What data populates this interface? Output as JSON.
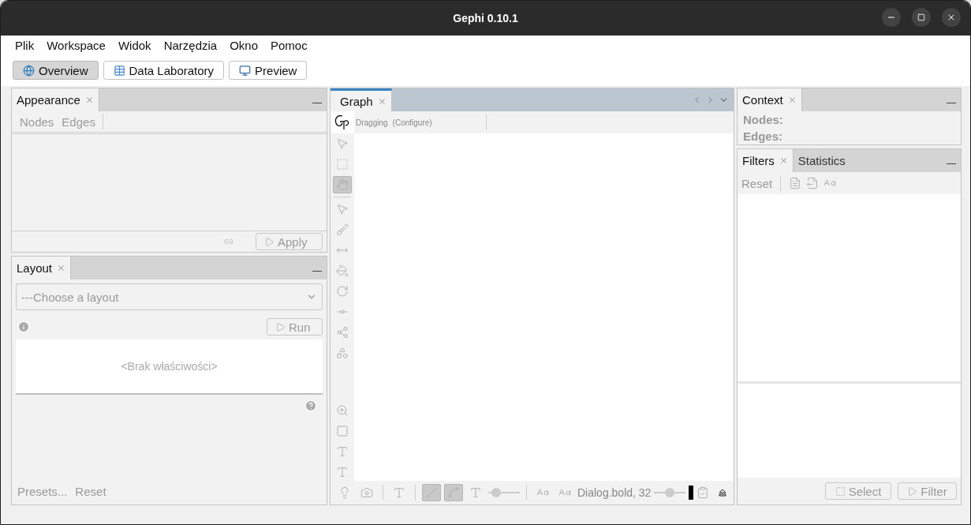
{
  "window": {
    "title": "Gephi 0.10.1"
  },
  "menu": [
    "Plik",
    "Workspace",
    "Widok",
    "Narzędzia",
    "Okno",
    "Pomoc"
  ],
  "perspectives": [
    {
      "label": "Overview",
      "kind": "globe",
      "selected": true
    },
    {
      "label": "Data Laboratory",
      "kind": "table",
      "selected": false
    },
    {
      "label": "Preview",
      "kind": "monitor",
      "selected": false
    }
  ],
  "appearance": {
    "tabs": [
      {
        "label": "Appearance",
        "selected": true
      }
    ],
    "subtabs": [
      "Nodes",
      "Edges"
    ],
    "apply": {
      "label": "Apply",
      "disabled": true
    }
  },
  "layout": {
    "tabs": [
      {
        "label": "Layout",
        "selected": true
      }
    ],
    "placeholder": "---Choose a layout",
    "run": {
      "label": "Run",
      "disabled": true
    },
    "properties": "<Brak właściwości>",
    "presets": "Presets...",
    "reset": "Reset"
  },
  "graph": {
    "tabs": [
      {
        "label": "Graph",
        "selected": true
      }
    ],
    "mode": "Dragging",
    "configure": "(Configure)",
    "tool_groups": [
      [
        {
          "kind": "pointer",
          "selected": false
        },
        {
          "kind": "rect-select",
          "selected": false
        },
        {
          "kind": "hand",
          "selected": true
        }
      ],
      [
        {
          "kind": "pointer-help",
          "selected": false
        },
        {
          "kind": "brush",
          "selected": false
        },
        {
          "kind": "resize",
          "selected": false
        },
        {
          "kind": "bucket",
          "selected": false
        },
        {
          "kind": "rotate",
          "selected": false
        },
        {
          "kind": "add-node",
          "selected": false
        },
        {
          "kind": "add-edge",
          "selected": false
        },
        {
          "kind": "cluster",
          "selected": false
        }
      ],
      [
        {
          "kind": "zoom",
          "selected": false
        },
        {
          "kind": "square",
          "selected": false
        },
        {
          "kind": "text-underline",
          "selected": false
        },
        {
          "kind": "text-shadow",
          "selected": false
        }
      ]
    ],
    "bottom_groups": [
      [
        {
          "kind": "bulb",
          "selected": false
        },
        {
          "kind": "camera",
          "selected": false
        }
      ],
      [
        {
          "kind": "text-bold",
          "selected": false
        }
      ],
      [
        {
          "kind": "edge",
          "selected": true
        },
        {
          "kind": "edge-curve",
          "selected": true
        },
        {
          "kind": "text-serif",
          "selected": false
        }
      ]
    ],
    "edge_slider": {
      "level": 0.15
    },
    "font_tools": [
      {
        "kind": "font-size",
        "selected": false
      },
      {
        "kind": "font-size",
        "selected": false
      }
    ],
    "font_label": "Dialog.bold, 32",
    "size_slider": {
      "level": 0.5
    }
  },
  "context": {
    "tabs": [
      {
        "label": "Context",
        "selected": true
      }
    ],
    "labels": [
      "Nodes:",
      "Edges:"
    ]
  },
  "filters": {
    "tabs": [
      {
        "label": "Filters",
        "selected": true
      },
      {
        "label": "Statistics",
        "selected": false
      }
    ],
    "reset": "Reset",
    "select": {
      "label": "Select",
      "disabled": true
    },
    "filter": {
      "label": "Filter",
      "disabled": true
    }
  }
}
